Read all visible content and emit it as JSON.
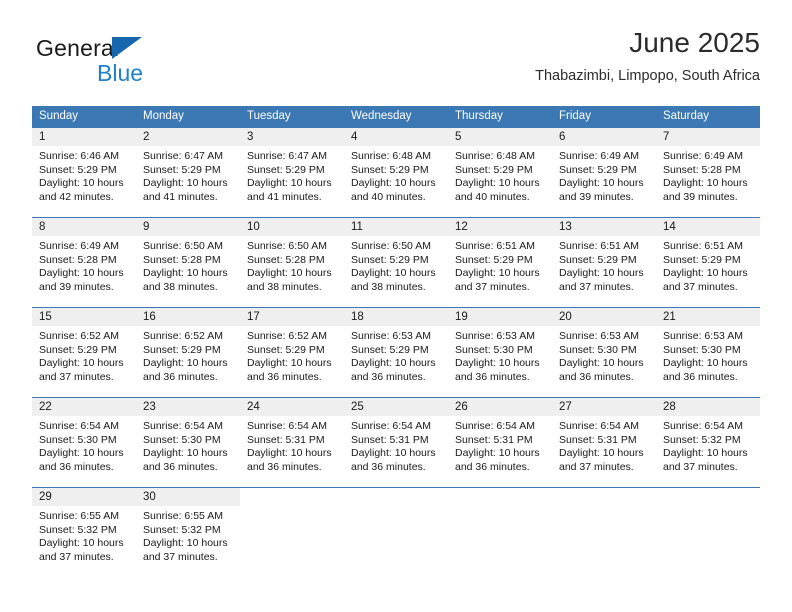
{
  "brand": {
    "name_top": "General",
    "name_bottom": "Blue",
    "accent_color": "#1f80d0",
    "triangle_color": "#1667ae"
  },
  "header": {
    "title": "June 2025",
    "subtitle": "Thabazimbi, Limpopo, South Africa"
  },
  "theme": {
    "header_blue": "#3b78b4",
    "daynum_gray": "#efefef",
    "text": "#1a1a1a"
  },
  "labels": {
    "sunrise_prefix": "Sunrise:",
    "sunset_prefix": "Sunset:",
    "daylight_prefix": "Daylight:"
  },
  "weekdays": [
    "Sunday",
    "Monday",
    "Tuesday",
    "Wednesday",
    "Thursday",
    "Friday",
    "Saturday"
  ],
  "weeks": [
    [
      {
        "day": "1",
        "sunrise": "Sunrise: 6:46 AM",
        "sunset": "Sunset: 5:29 PM",
        "daylight1": "Daylight: 10 hours",
        "daylight2": "and 42 minutes."
      },
      {
        "day": "2",
        "sunrise": "Sunrise: 6:47 AM",
        "sunset": "Sunset: 5:29 PM",
        "daylight1": "Daylight: 10 hours",
        "daylight2": "and 41 minutes."
      },
      {
        "day": "3",
        "sunrise": "Sunrise: 6:47 AM",
        "sunset": "Sunset: 5:29 PM",
        "daylight1": "Daylight: 10 hours",
        "daylight2": "and 41 minutes."
      },
      {
        "day": "4",
        "sunrise": "Sunrise: 6:48 AM",
        "sunset": "Sunset: 5:29 PM",
        "daylight1": "Daylight: 10 hours",
        "daylight2": "and 40 minutes."
      },
      {
        "day": "5",
        "sunrise": "Sunrise: 6:48 AM",
        "sunset": "Sunset: 5:29 PM",
        "daylight1": "Daylight: 10 hours",
        "daylight2": "and 40 minutes."
      },
      {
        "day": "6",
        "sunrise": "Sunrise: 6:49 AM",
        "sunset": "Sunset: 5:29 PM",
        "daylight1": "Daylight: 10 hours",
        "daylight2": "and 39 minutes."
      },
      {
        "day": "7",
        "sunrise": "Sunrise: 6:49 AM",
        "sunset": "Sunset: 5:28 PM",
        "daylight1": "Daylight: 10 hours",
        "daylight2": "and 39 minutes."
      }
    ],
    [
      {
        "day": "8",
        "sunrise": "Sunrise: 6:49 AM",
        "sunset": "Sunset: 5:28 PM",
        "daylight1": "Daylight: 10 hours",
        "daylight2": "and 39 minutes."
      },
      {
        "day": "9",
        "sunrise": "Sunrise: 6:50 AM",
        "sunset": "Sunset: 5:28 PM",
        "daylight1": "Daylight: 10 hours",
        "daylight2": "and 38 minutes."
      },
      {
        "day": "10",
        "sunrise": "Sunrise: 6:50 AM",
        "sunset": "Sunset: 5:28 PM",
        "daylight1": "Daylight: 10 hours",
        "daylight2": "and 38 minutes."
      },
      {
        "day": "11",
        "sunrise": "Sunrise: 6:50 AM",
        "sunset": "Sunset: 5:29 PM",
        "daylight1": "Daylight: 10 hours",
        "daylight2": "and 38 minutes."
      },
      {
        "day": "12",
        "sunrise": "Sunrise: 6:51 AM",
        "sunset": "Sunset: 5:29 PM",
        "daylight1": "Daylight: 10 hours",
        "daylight2": "and 37 minutes."
      },
      {
        "day": "13",
        "sunrise": "Sunrise: 6:51 AM",
        "sunset": "Sunset: 5:29 PM",
        "daylight1": "Daylight: 10 hours",
        "daylight2": "and 37 minutes."
      },
      {
        "day": "14",
        "sunrise": "Sunrise: 6:51 AM",
        "sunset": "Sunset: 5:29 PM",
        "daylight1": "Daylight: 10 hours",
        "daylight2": "and 37 minutes."
      }
    ],
    [
      {
        "day": "15",
        "sunrise": "Sunrise: 6:52 AM",
        "sunset": "Sunset: 5:29 PM",
        "daylight1": "Daylight: 10 hours",
        "daylight2": "and 37 minutes."
      },
      {
        "day": "16",
        "sunrise": "Sunrise: 6:52 AM",
        "sunset": "Sunset: 5:29 PM",
        "daylight1": "Daylight: 10 hours",
        "daylight2": "and 36 minutes."
      },
      {
        "day": "17",
        "sunrise": "Sunrise: 6:52 AM",
        "sunset": "Sunset: 5:29 PM",
        "daylight1": "Daylight: 10 hours",
        "daylight2": "and 36 minutes."
      },
      {
        "day": "18",
        "sunrise": "Sunrise: 6:53 AM",
        "sunset": "Sunset: 5:29 PM",
        "daylight1": "Daylight: 10 hours",
        "daylight2": "and 36 minutes."
      },
      {
        "day": "19",
        "sunrise": "Sunrise: 6:53 AM",
        "sunset": "Sunset: 5:30 PM",
        "daylight1": "Daylight: 10 hours",
        "daylight2": "and 36 minutes."
      },
      {
        "day": "20",
        "sunrise": "Sunrise: 6:53 AM",
        "sunset": "Sunset: 5:30 PM",
        "daylight1": "Daylight: 10 hours",
        "daylight2": "and 36 minutes."
      },
      {
        "day": "21",
        "sunrise": "Sunrise: 6:53 AM",
        "sunset": "Sunset: 5:30 PM",
        "daylight1": "Daylight: 10 hours",
        "daylight2": "and 36 minutes."
      }
    ],
    [
      {
        "day": "22",
        "sunrise": "Sunrise: 6:54 AM",
        "sunset": "Sunset: 5:30 PM",
        "daylight1": "Daylight: 10 hours",
        "daylight2": "and 36 minutes."
      },
      {
        "day": "23",
        "sunrise": "Sunrise: 6:54 AM",
        "sunset": "Sunset: 5:30 PM",
        "daylight1": "Daylight: 10 hours",
        "daylight2": "and 36 minutes."
      },
      {
        "day": "24",
        "sunrise": "Sunrise: 6:54 AM",
        "sunset": "Sunset: 5:31 PM",
        "daylight1": "Daylight: 10 hours",
        "daylight2": "and 36 minutes."
      },
      {
        "day": "25",
        "sunrise": "Sunrise: 6:54 AM",
        "sunset": "Sunset: 5:31 PM",
        "daylight1": "Daylight: 10 hours",
        "daylight2": "and 36 minutes."
      },
      {
        "day": "26",
        "sunrise": "Sunrise: 6:54 AM",
        "sunset": "Sunset: 5:31 PM",
        "daylight1": "Daylight: 10 hours",
        "daylight2": "and 36 minutes."
      },
      {
        "day": "27",
        "sunrise": "Sunrise: 6:54 AM",
        "sunset": "Sunset: 5:31 PM",
        "daylight1": "Daylight: 10 hours",
        "daylight2": "and 37 minutes."
      },
      {
        "day": "28",
        "sunrise": "Sunrise: 6:54 AM",
        "sunset": "Sunset: 5:32 PM",
        "daylight1": "Daylight: 10 hours",
        "daylight2": "and 37 minutes."
      }
    ],
    [
      {
        "day": "29",
        "sunrise": "Sunrise: 6:55 AM",
        "sunset": "Sunset: 5:32 PM",
        "daylight1": "Daylight: 10 hours",
        "daylight2": "and 37 minutes."
      },
      {
        "day": "30",
        "sunrise": "Sunrise: 6:55 AM",
        "sunset": "Sunset: 5:32 PM",
        "daylight1": "Daylight: 10 hours",
        "daylight2": "and 37 minutes."
      },
      {
        "day": "",
        "sunrise": "",
        "sunset": "",
        "daylight1": "",
        "daylight2": ""
      },
      {
        "day": "",
        "sunrise": "",
        "sunset": "",
        "daylight1": "",
        "daylight2": ""
      },
      {
        "day": "",
        "sunrise": "",
        "sunset": "",
        "daylight1": "",
        "daylight2": ""
      },
      {
        "day": "",
        "sunrise": "",
        "sunset": "",
        "daylight1": "",
        "daylight2": ""
      },
      {
        "day": "",
        "sunrise": "",
        "sunset": "",
        "daylight1": "",
        "daylight2": ""
      }
    ]
  ]
}
